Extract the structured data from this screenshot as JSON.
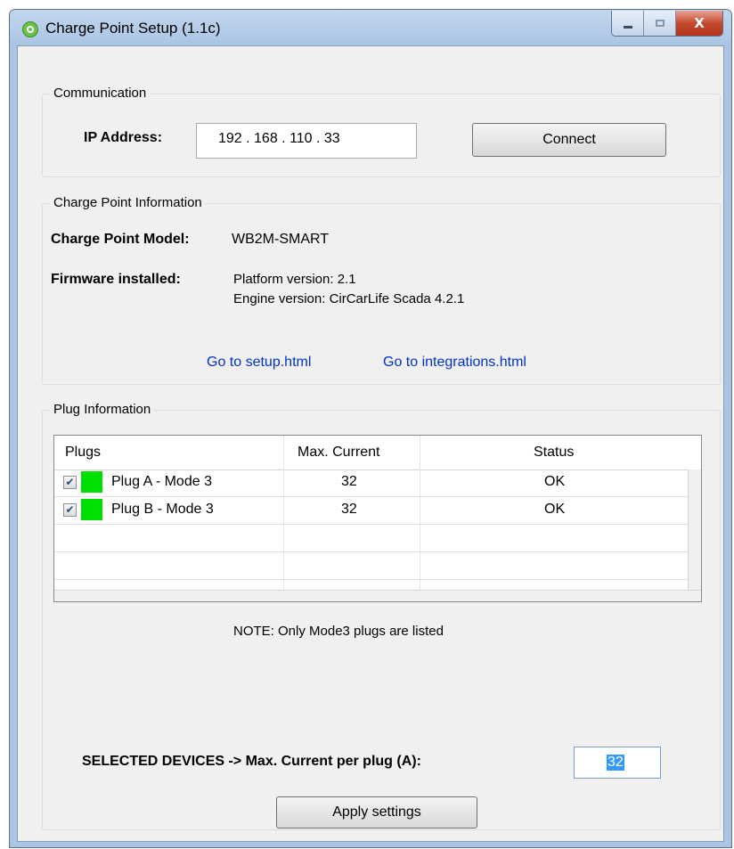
{
  "window": {
    "title": "Charge Point Setup (1.1c)",
    "close_label": "X"
  },
  "communication": {
    "legend": "Communication",
    "ip_label": "IP Address:",
    "ip_value": "192 . 168 . 110 . 33",
    "connect_label": "Connect"
  },
  "info": {
    "legend": "Charge Point Information",
    "model_label": "Charge Point Model:",
    "model_value": "WB2M-SMART",
    "firmware_label": "Firmware installed:",
    "platform_version": "Platform version: 2.1",
    "engine_version": "Engine version: CirCarLife Scada 4.2.1",
    "link_setup": "Go to setup.html",
    "link_integrations": "Go to integrations.html"
  },
  "plugs": {
    "legend": "Plug Information",
    "columns": [
      "Plugs",
      "Max. Current",
      "Status"
    ],
    "rows": [
      {
        "name": "Plug A - Mode 3",
        "checked": "✔",
        "max_current": "32",
        "status": "OK",
        "color": "#00e000"
      },
      {
        "name": "Plug B - Mode 3",
        "checked": "✔",
        "max_current": "32",
        "status": "OK",
        "color": "#00e000"
      }
    ],
    "note": "NOTE: Only Mode3 plugs are listed",
    "selected_label": "SELECTED DEVICES -> Max. Current per plug (A):",
    "current_value": "32",
    "apply_label": "Apply settings"
  }
}
